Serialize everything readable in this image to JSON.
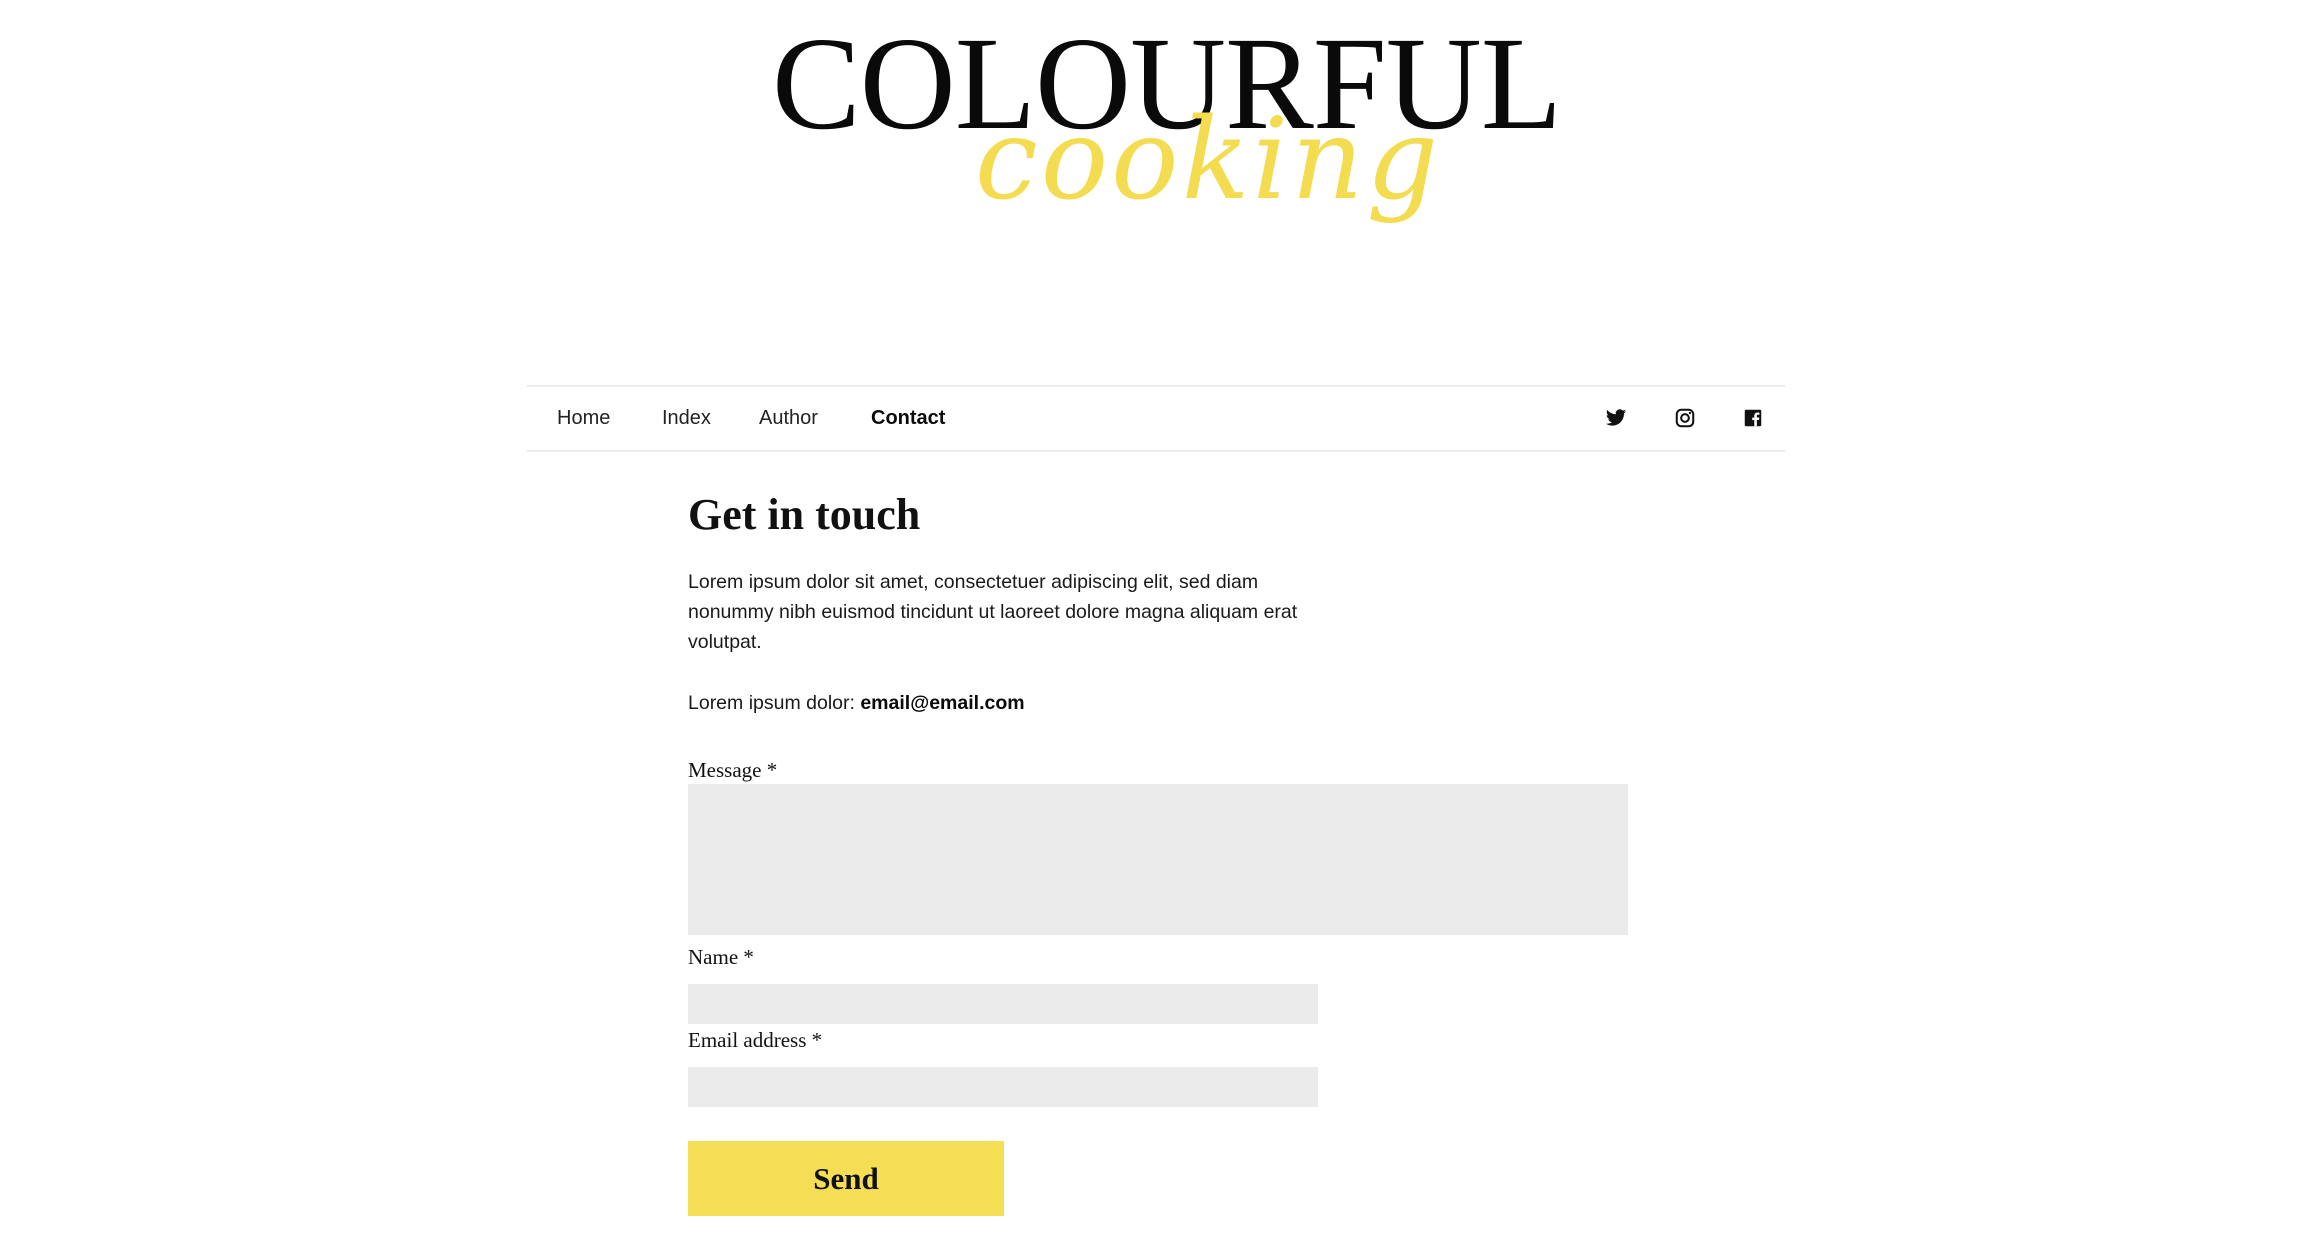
{
  "brand": {
    "title": "COLOURFUL",
    "script": "cooking",
    "title_color": "#0a0a0a",
    "script_color": "#f3dc50"
  },
  "nav": {
    "links": [
      {
        "label": "Home",
        "active": false
      },
      {
        "label": "Index",
        "active": false
      },
      {
        "label": "Author",
        "active": false
      },
      {
        "label": "Contact",
        "active": true
      }
    ],
    "social": [
      {
        "icon": "twitter-icon"
      },
      {
        "icon": "instagram-icon"
      },
      {
        "icon": "facebook-icon"
      }
    ]
  },
  "contact": {
    "heading": "Get in touch",
    "intro": "Lorem ipsum dolor sit amet, consectetuer adipiscing elit, sed diam nonummy nibh euismod tincidunt ut laoreet dolore magna aliquam erat volutpat.",
    "email_prefix": "Lorem ipsum dolor: ",
    "email": "email@email.com",
    "form": {
      "message_label": "Message *",
      "message_value": "",
      "name_label": "Name *",
      "name_value": "",
      "email_label": "Email address *",
      "email_value": "",
      "submit_label": "Send"
    }
  },
  "colors": {
    "accent": "#f4de53",
    "field_background": "#ebebeb",
    "divider": "#ececec"
  }
}
